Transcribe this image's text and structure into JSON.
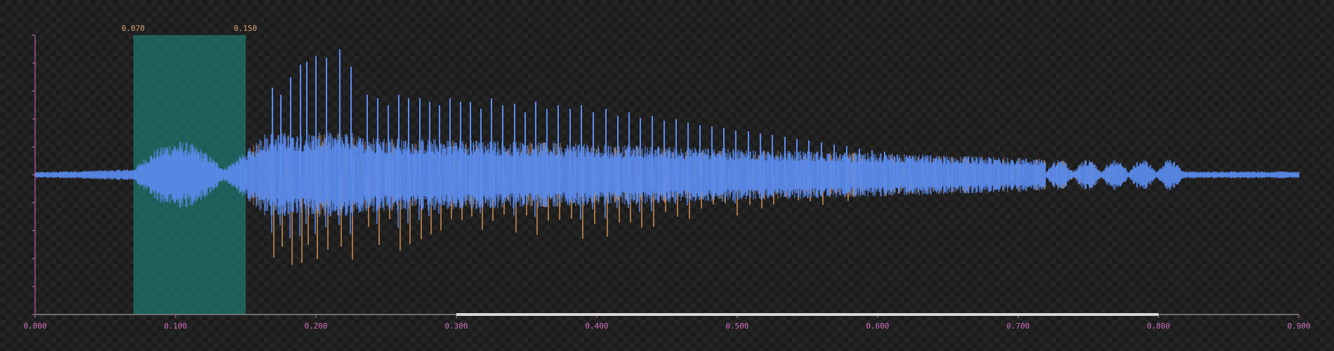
{
  "selection": {
    "start_label": "0.070",
    "end_label": "0.150",
    "start": 0.07,
    "end": 0.15
  },
  "x_axis": {
    "min": 0.0,
    "max": 0.9,
    "ticks": [
      {
        "value": 0.0,
        "label": "0.000"
      },
      {
        "value": 0.1,
        "label": "0.100"
      },
      {
        "value": 0.2,
        "label": "0.200"
      },
      {
        "value": 0.3,
        "label": "0.300"
      },
      {
        "value": 0.4,
        "label": "0.400"
      },
      {
        "value": 0.5,
        "label": "0.500"
      },
      {
        "value": 0.6,
        "label": "0.600"
      },
      {
        "value": 0.7,
        "label": "0.700"
      },
      {
        "value": 0.8,
        "label": "0.800"
      },
      {
        "value": 0.9,
        "label": "0.900"
      }
    ]
  },
  "scroll": {
    "visible_start": 0.3,
    "visible_end": 0.8
  },
  "colors": {
    "background": "#1c1c1c",
    "selection": "#1e7a70",
    "channel_1": "#5b8def",
    "channel_2": "#c98a4e",
    "axis": "#d070c0",
    "selection_label": "#d9a070",
    "scrollbar": "#707070",
    "scroll_thumb": "#d8d8d8"
  }
}
